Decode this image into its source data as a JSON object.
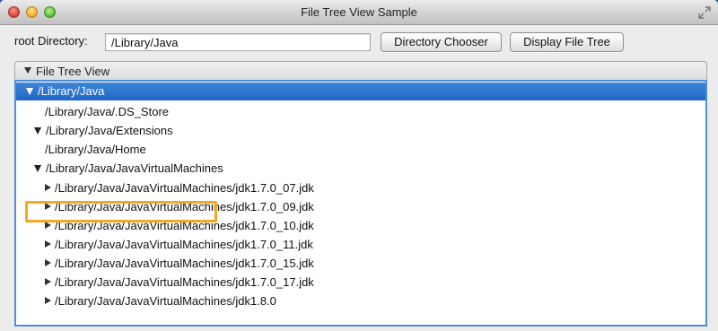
{
  "window": {
    "title": "File Tree View Sample"
  },
  "toolbar": {
    "root_label": "root Directory:",
    "path_value": "/Library/Java",
    "chooser_label": "Directory Chooser",
    "display_label": "Display File Tree"
  },
  "panel": {
    "title": "File Tree View"
  },
  "tree": {
    "rows": [
      {
        "label": "/Library/Java",
        "state": "expanded",
        "selected": true
      },
      {
        "label": "/Library/Java/.DS_Store",
        "state": "leaf"
      },
      {
        "label": "/Library/Java/Extensions",
        "state": "expanded"
      },
      {
        "label": "/Library/Java/Home",
        "state": "leaf"
      },
      {
        "label": "/Library/Java/JavaVirtualMachines",
        "state": "expanded"
      },
      {
        "label": "/Library/Java/JavaVirtualMachines/jdk1.7.0_07.jdk",
        "state": "collapsed"
      },
      {
        "label": "/Library/Java/JavaVirtualMachines/jdk1.7.0_09.jdk",
        "state": "collapsed"
      },
      {
        "label": "/Library/Java/JavaVirtualMachines/jdk1.7.0_10.jdk",
        "state": "collapsed"
      },
      {
        "label": "/Library/Java/JavaVirtualMachines/jdk1.7.0_11.jdk",
        "state": "collapsed"
      },
      {
        "label": "/Library/Java/JavaVirtualMachines/jdk1.7.0_15.jdk",
        "state": "collapsed"
      },
      {
        "label": "/Library/Java/JavaVirtualMachines/jdk1.7.0_17.jdk",
        "state": "collapsed"
      },
      {
        "label": "/Library/Java/JavaVirtualMachines/jdk1.8.0",
        "state": "collapsed"
      }
    ]
  },
  "colors": {
    "selection": "#1f66c6",
    "focus_border": "#4d8fd1",
    "highlight_box": "#f2a922"
  },
  "icons": {
    "close": "close-icon",
    "minimize": "minimize-icon",
    "zoom": "zoom-icon",
    "fullscreen": "fullscreen-icon",
    "expanded": "triangle-down-icon",
    "collapsed": "triangle-right-icon"
  }
}
